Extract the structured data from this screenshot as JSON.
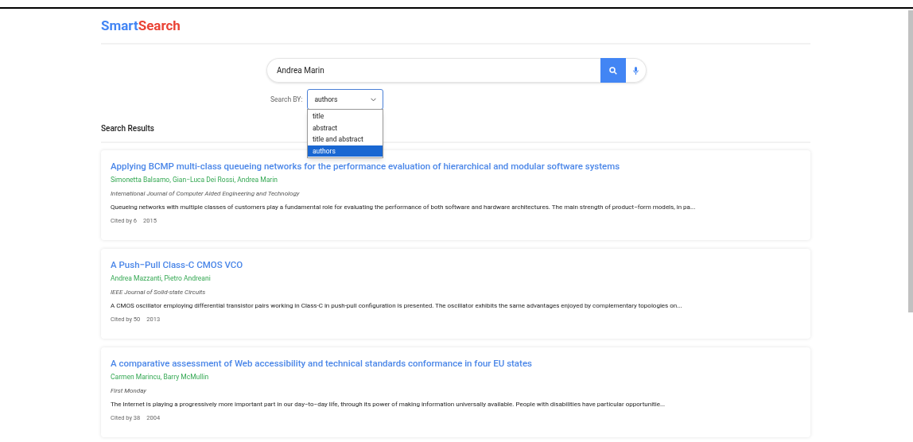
{
  "logo": {
    "first": "Smart",
    "second": "Search"
  },
  "search": {
    "value": "Andrea Marin"
  },
  "search_by": {
    "label": "Search BY:",
    "value": "authors",
    "options": [
      {
        "label": "title",
        "selected": false
      },
      {
        "label": "abstract",
        "selected": false
      },
      {
        "label": "title and abstract",
        "selected": false
      },
      {
        "label": "authors",
        "selected": true
      }
    ]
  },
  "results_heading": "Search Results",
  "results": [
    {
      "title": "Applying BCMP multi-class queueing networks for the performance evaluation of hierarchical and modular software systems",
      "authors": "Simonetta Balsamo, Gian−Luca Dei Rossi, Andrea Marin",
      "venue": "International Journal of Computer Aided Engineering and Technology",
      "abstract": "Queueing networks with multiple classes of customers play a fundamental role for evaluating the performance of both software and hardware architectures. The main strength of product−form models, in pa...",
      "cited": "Cited by 6",
      "year": "2015"
    },
    {
      "title": "A Push−Pull Class-C CMOS VCO",
      "authors": "Andrea Mazzanti, Pietro Andreani",
      "venue": "IEEE Journal of Solid-state Circuits",
      "abstract": "A CMOS oscillator employing differential transistor pairs working in Class-C in push-pull configuration is presented. The oscillator exhibits the same advantages enjoyed by complementary topologies on...",
      "cited": "Cited by 50",
      "year": "2013"
    },
    {
      "title": "A comparative assessment of Web accessibility and technical standards conformance in four EU states",
      "authors": "Carmen Marincu, Barry McMullin",
      "venue": "First Monday",
      "abstract": "The Internet is playing a progressively more important part in our day−to−day life, through its power of making information universally available. People with disabilities have particular opportunitie...",
      "cited": "Cited by 38",
      "year": "2004"
    }
  ]
}
